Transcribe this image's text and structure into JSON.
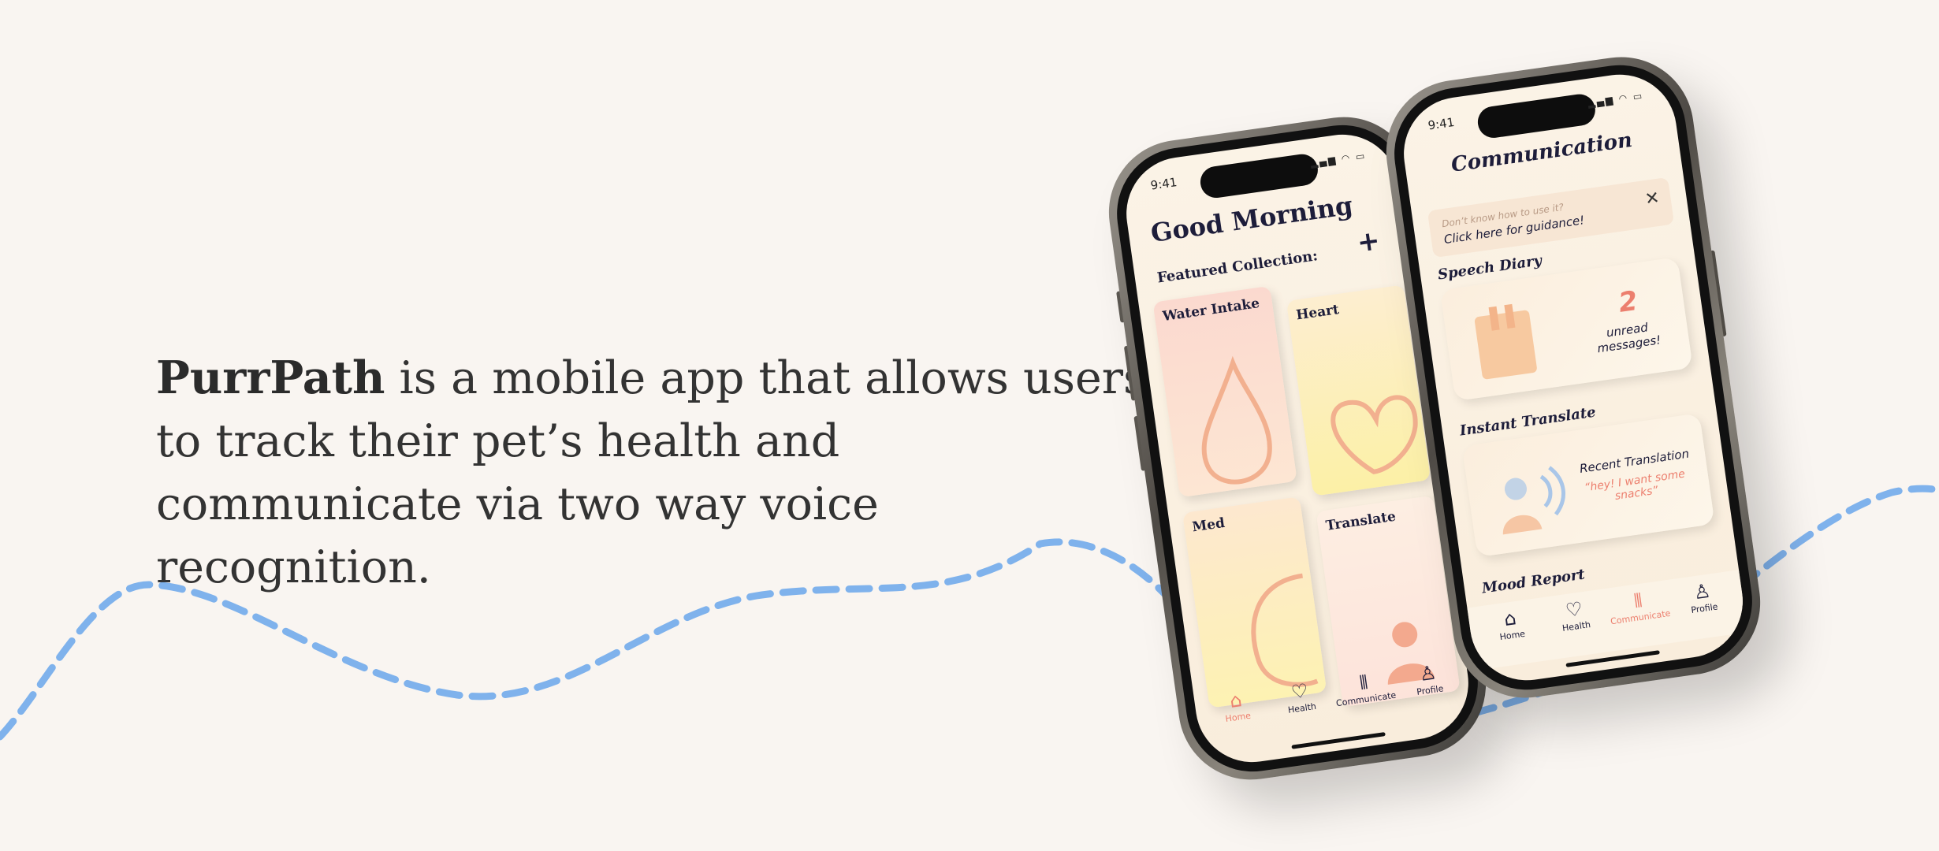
{
  "headline": {
    "brand": "PurrPath",
    "text": " is a mobile app that allows users to track their pet’s health and communicate via two way voice recognition."
  },
  "colors": {
    "accent": "#ec7f6e",
    "wave": "#7fb2ec",
    "background": "#f9f5f1"
  },
  "phone_home": {
    "time": "9:41",
    "status_icons": "signal wifi battery",
    "title": "Good Morning",
    "subtitle": "Featured Collection:",
    "add_icon": "+",
    "cards": [
      {
        "label": "Water Intake",
        "icon": "drop-icon"
      },
      {
        "label": "Heart",
        "icon": "heart-icon"
      },
      {
        "label": "Med",
        "icon": "pill-icon"
      },
      {
        "label": "Translate",
        "icon": "person-icon"
      }
    ],
    "tabs": [
      {
        "label": "Home",
        "icon": "⌂",
        "active": true
      },
      {
        "label": "Health",
        "icon": "♡"
      },
      {
        "label": "Communicate",
        "icon": "⦀"
      },
      {
        "label": "Profile",
        "icon": "♙"
      }
    ]
  },
  "phone_comm": {
    "time": "9:41",
    "title": "Communication",
    "guide": {
      "line1": "Don’t know how to use it?",
      "line2": "Click here for guidance!"
    },
    "speech_diary": {
      "title": "Speech Diary",
      "count": "2",
      "label": "unread messages!"
    },
    "instant_translate": {
      "title": "Instant Translate",
      "label": "Recent Translation",
      "quote": "“hey! I want some snacks”"
    },
    "mood_report": {
      "title": "Mood Report"
    },
    "tabs": [
      {
        "label": "Home",
        "icon": "⌂"
      },
      {
        "label": "Health",
        "icon": "♡"
      },
      {
        "label": "Communicate",
        "icon": "⦀",
        "active": true
      },
      {
        "label": "Profile",
        "icon": "♙"
      }
    ]
  }
}
